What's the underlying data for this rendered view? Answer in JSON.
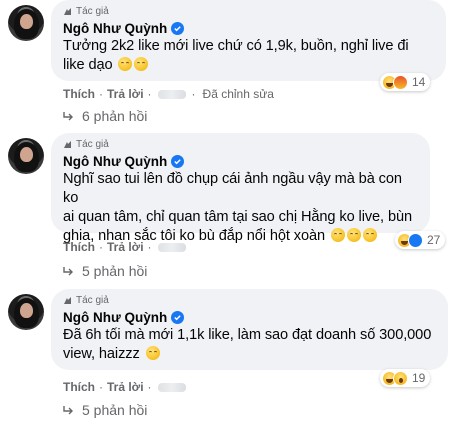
{
  "comments": [
    {
      "author_tag": "Tác giả",
      "name": "Ngô Như Quỳnh",
      "lines": [
        "Tưởng 2k2 like mới live chứ có 1,9k, buồn, nghỉ live đi",
        "like dạo"
      ],
      "reaction_count": "14",
      "reaction_icons": [
        "haha-icon",
        "angry-icon"
      ],
      "like_label": "Thích",
      "reply_label": "Trả lời",
      "edited_label": "Đã chỉnh sửa",
      "replies_label": "6 phản hồi"
    },
    {
      "author_tag": "Tác giả",
      "name": "Ngô Như Quỳnh",
      "lines": [
        "Nghĩ sao tui lên đồ chụp cái ảnh ngầu vậy mà bà con ko",
        "ai quan tâm, chỉ quan tâm tại sao chị Hằng ko live, bùn",
        "ghia, nhan sắc tôi ko bù đắp nổi hột xoàn"
      ],
      "reaction_count": "27",
      "reaction_icons": [
        "haha-icon",
        "like-icon"
      ],
      "like_label": "Thích",
      "reply_label": "Trả lời",
      "replies_label": "5 phản hồi"
    },
    {
      "author_tag": "Tác giả",
      "name": "Ngô Như Quỳnh",
      "lines": [
        "Đã 6h tối mà mới 1,1k like, làm sao đạt doanh số 300,000",
        "view, haizzz"
      ],
      "reaction_count": "19",
      "reaction_icons": [
        "haha-icon",
        "wow-icon"
      ],
      "like_label": "Thích",
      "reply_label": "Trả lời",
      "replies_label": "5 phản hồi"
    }
  ],
  "colors": {
    "bubble": "#f0f2f5",
    "secondary_text": "#65676b",
    "verified": "#1877f2"
  }
}
